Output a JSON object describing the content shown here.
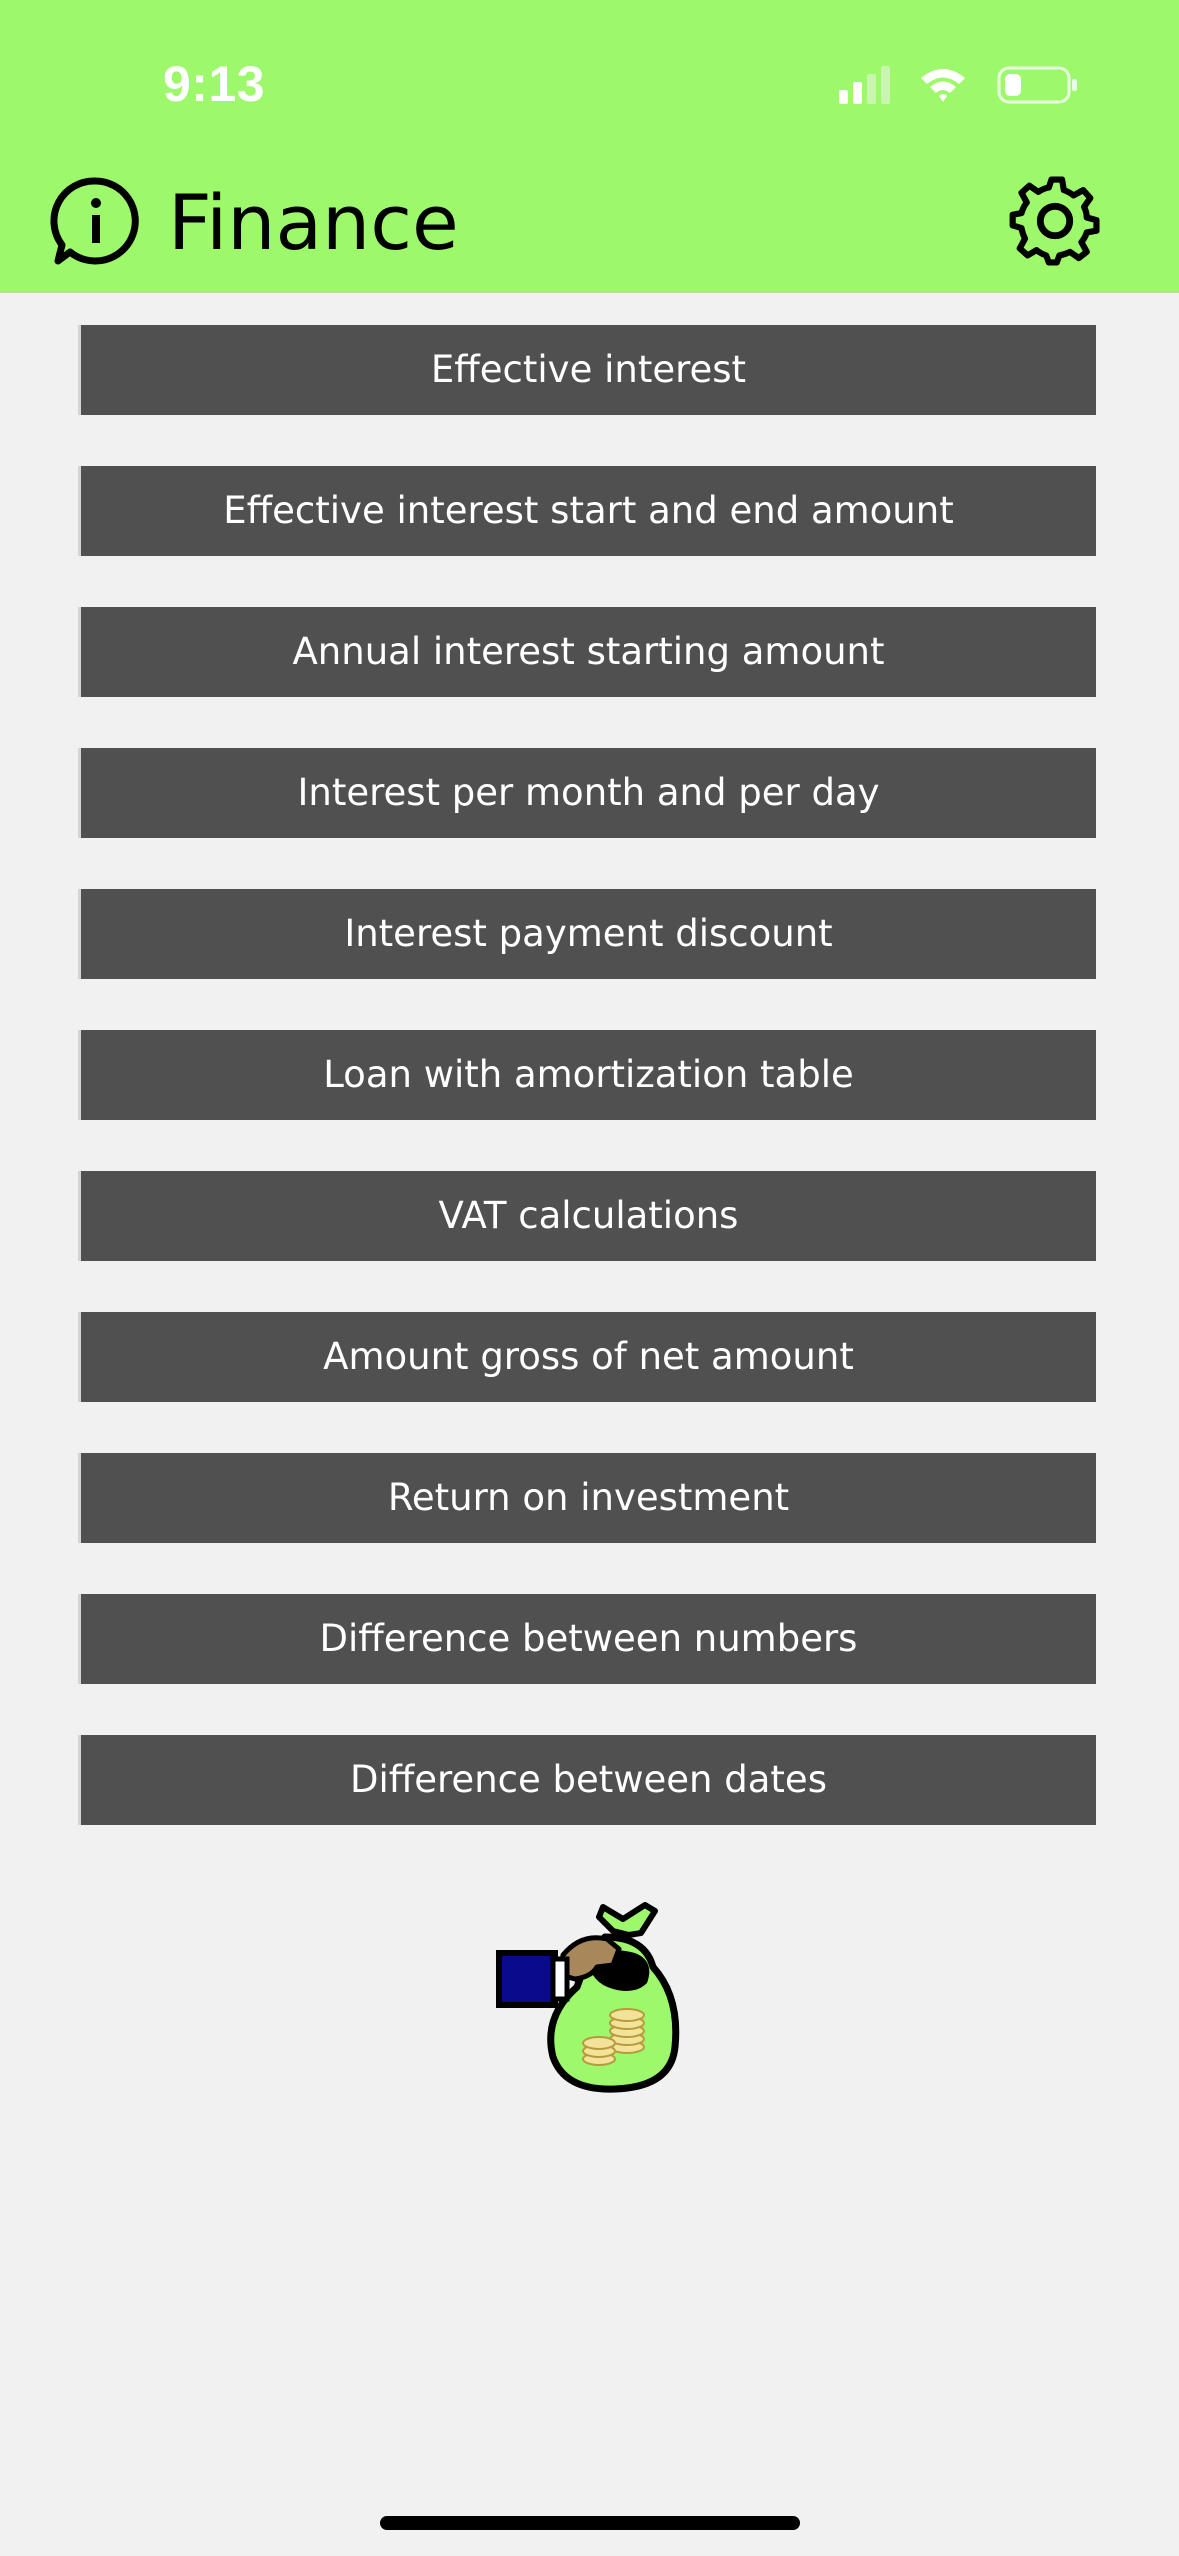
{
  "status_bar": {
    "time": "9:13"
  },
  "header": {
    "title": "Finance",
    "background_color": "#9df86b",
    "left_icon": "info-icon",
    "right_icon": "gear-icon"
  },
  "menu": {
    "button_color": "#505050",
    "items": [
      {
        "label": "Effective interest"
      },
      {
        "label": "Effective interest start and end amount"
      },
      {
        "label": "Annual interest starting amount"
      },
      {
        "label": "Interest per month and per day"
      },
      {
        "label": "Interest payment discount"
      },
      {
        "label": "Loan with amortization table"
      },
      {
        "label": "VAT calculations"
      },
      {
        "label": "Amount gross of net amount"
      },
      {
        "label": "Return on investment"
      },
      {
        "label": "Difference between numbers"
      },
      {
        "label": "Difference between dates"
      }
    ]
  },
  "illustration": {
    "icon": "money-bag-icon"
  }
}
